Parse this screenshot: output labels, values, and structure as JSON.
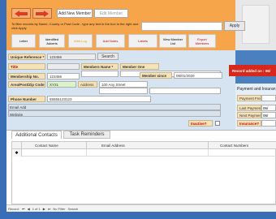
{
  "toolbar": {
    "add_new_member": "Add New Member",
    "edit_member": "Edit Member",
    "filter_hint": "To filter records by Name, County or Post Code - type any text in the box to the right and click Apply",
    "apply": "Apply"
  },
  "actions": {
    "letter": "Letter",
    "identified_adverts": "Identified Adverts",
    "web_log": "Web Log",
    "add_notes": "Add Notes",
    "labels": "Labels",
    "view_member_list": "View Member List",
    "export_members": "Export Members"
  },
  "form": {
    "unique_reference_label": "Unique Reference *",
    "unique_reference_value": "123456",
    "search": "Search",
    "title_label": "Title",
    "members_name_label": "Members Name *",
    "member_one": "Member One",
    "membership_no_label": "Membership No.",
    "membership_no_value": "123456",
    "member_since_label": "Member since",
    "member_since_value": "06/01/2020",
    "area_post_zip_label": "Area/Post/Zip Code",
    "area_post_zip_value": "XY21",
    "address_label": "Address",
    "address_value": "100 Any Street",
    "phone_label": "Phone Number",
    "phone_value": "55555123123",
    "email_label": "Email Add",
    "website_label": "Website",
    "inactive_label": "Inactive?"
  },
  "record_added": "Record added on : 06/",
  "payment": {
    "title": "Payment and Insuran",
    "frequency_label": "Payment Frequency:",
    "last_payment_label": "Last Payment:",
    "last_payment_value": "06/",
    "next_payment_label": "Next Payment:",
    "next_payment_value": "06/",
    "insurance_label": "Insurance?"
  },
  "subform": {
    "tabs": [
      "Additional Contacts",
      "Task Reminders"
    ],
    "columns": [
      "Contact Name",
      "Email Address",
      "Contact Numbers"
    ]
  },
  "status": {
    "record_prefix": "Record:",
    "nav_first": "⏮",
    "nav_prev": "◀",
    "position": "1 of 1",
    "nav_next": "▶",
    "nav_last": "⏭",
    "filter_state": "No Filter",
    "search": "Search"
  },
  "colors": {
    "header_orange": "#f7a54a",
    "accent_blue": "#3a6db8",
    "alert_red": "#d9281b",
    "label_beige": "#f5e2b8"
  }
}
